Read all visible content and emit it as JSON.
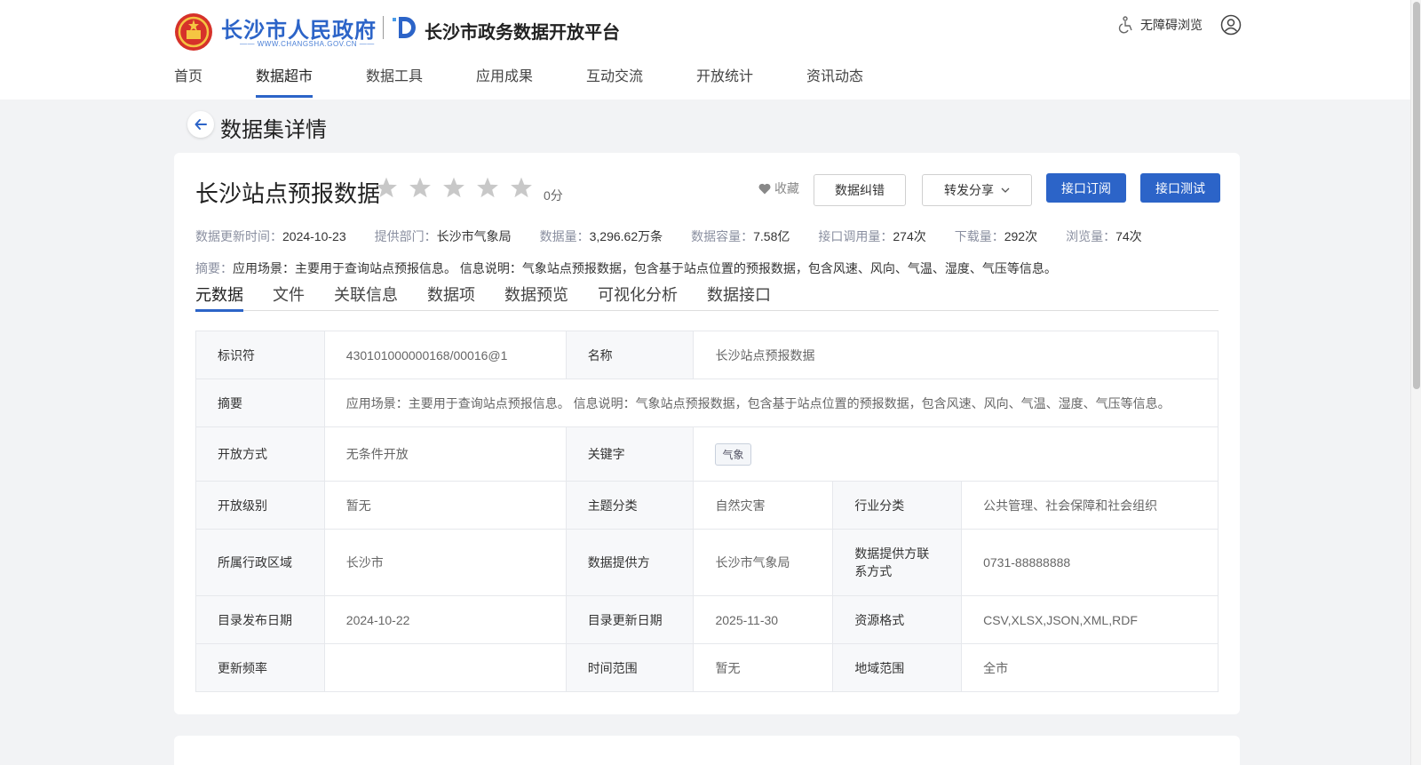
{
  "colors": {
    "primary": "#2c64c8",
    "logo_red": "#d6322a",
    "star_gray": "#c8c8c8"
  },
  "header": {
    "logo_text": "长沙市人民政府",
    "logo_sub": "—— WWW.CHANGSHA.GOV.CN ——",
    "platform_title": "长沙市政务数据开放平台",
    "accessibility_label": "无障碍浏览"
  },
  "nav": {
    "items": [
      {
        "label": "首页"
      },
      {
        "label": "数据超市"
      },
      {
        "label": "数据工具"
      },
      {
        "label": "应用成果"
      },
      {
        "label": "互动交流"
      },
      {
        "label": "开放统计"
      },
      {
        "label": "资讯动态"
      }
    ],
    "active_index": 1
  },
  "page": {
    "title": "数据集详情"
  },
  "dataset": {
    "title": "长沙站点预报数据",
    "rating": 0,
    "rating_max": 5,
    "score_text": "0分",
    "favorite_label": "收藏",
    "buttons": {
      "correction": "数据纠错",
      "share": "转发分享",
      "subscribe": "接口订阅",
      "test": "接口测试"
    },
    "meta": [
      {
        "label": "数据更新时间：",
        "value": "2024-10-23"
      },
      {
        "label": "提供部门：",
        "value": "长沙市气象局"
      },
      {
        "label": "数据量：",
        "value": "3,296.62万条"
      },
      {
        "label": "数据容量：",
        "value": "7.58亿"
      },
      {
        "label": "接口调用量：",
        "value": "274次"
      },
      {
        "label": "下载量：",
        "value": "292次"
      },
      {
        "label": "浏览量：",
        "value": "74次"
      }
    ],
    "summary_label": "摘要：",
    "summary_text": "应用场景：主要用于查询站点预报信息。 信息说明：气象站点预报数据，包含基于站点位置的预报数据，包含风速、风向、气温、湿度、气压等信息。"
  },
  "tabs": [
    {
      "label": "元数据"
    },
    {
      "label": "文件"
    },
    {
      "label": "关联信息"
    },
    {
      "label": "数据项"
    },
    {
      "label": "数据预览"
    },
    {
      "label": "可视化分析"
    },
    {
      "label": "数据接口"
    }
  ],
  "table": {
    "identifier_label": "标识符",
    "identifier_value": "430101000000168/00016@1",
    "name_label": "名称",
    "name_value": "长沙站点预报数据",
    "summary_label": "摘要",
    "summary_value": "应用场景：主要用于查询站点预报信息。 信息说明：气象站点预报数据，包含基于站点位置的预报数据，包含风速、风向、气温、湿度、气压等信息。",
    "open_mode_label": "开放方式",
    "open_mode_value": "无条件开放",
    "keyword_label": "关键字",
    "keyword_tag": "气象",
    "open_level_label": "开放级别",
    "open_level_value": "暂无",
    "theme_label": "主题分类",
    "theme_value": "自然灾害",
    "industry_label": "行业分类",
    "industry_value": "公共管理、社会保障和社会组织",
    "region_label": "所属行政区域",
    "region_value": "长沙市",
    "provider_label": "数据提供方",
    "provider_value": "长沙市气象局",
    "contact_label": "数据提供方联系方式",
    "contact_value": "0731-88888888",
    "publish_date_label": "目录发布日期",
    "publish_date_value": "2024-10-22",
    "update_date_label": "目录更新日期",
    "update_date_value": "2025-11-30",
    "format_label": "资源格式",
    "format_value": "CSV,XLSX,JSON,XML,RDF",
    "frequency_label": "更新频率",
    "frequency_value": "",
    "time_range_label": "时间范围",
    "time_range_value": "暂无",
    "geo_range_label": "地域范围",
    "geo_range_value": "全市"
  }
}
